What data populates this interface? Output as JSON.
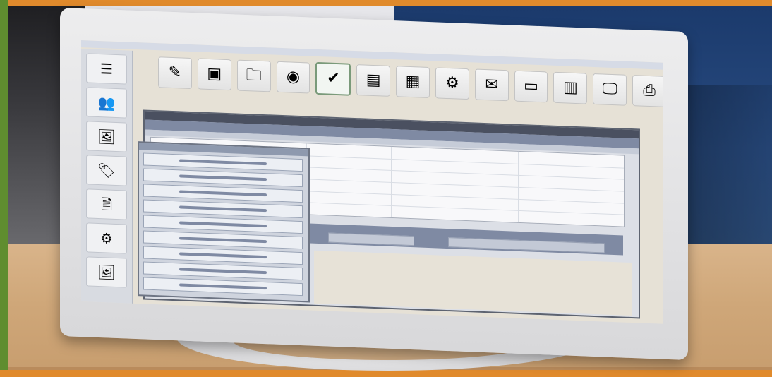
{
  "scene": {
    "description": "",
    "colors": {
      "frame_orange": "#e08a2c",
      "frame_green": "#5f8d2f",
      "desk": "#cfa779",
      "monitor_bezel": "#e2e2e4",
      "wall_blue": "#284b80"
    }
  },
  "toolbar": {
    "buttons": [
      {
        "icon": "pen-icon",
        "label": ""
      },
      {
        "icon": "box-icon",
        "label": ""
      },
      {
        "icon": "folder-icon",
        "label": ""
      },
      {
        "icon": "record-icon",
        "label": ""
      },
      {
        "icon": "check-icon",
        "label": ""
      },
      {
        "icon": "chart-icon",
        "label": ""
      },
      {
        "icon": "document-icon",
        "label": ""
      },
      {
        "icon": "cog-icon",
        "label": ""
      },
      {
        "icon": "mail-icon",
        "label": ""
      },
      {
        "icon": "window-icon",
        "label": ""
      },
      {
        "icon": "table-icon",
        "label": ""
      },
      {
        "icon": "monitor-icon",
        "label": ""
      },
      {
        "icon": "print-icon",
        "label": ""
      }
    ]
  },
  "sidebar": {
    "buttons": [
      {
        "icon": "list-icon"
      },
      {
        "icon": "people-icon"
      },
      {
        "icon": "image-icon"
      },
      {
        "icon": "tag-icon"
      },
      {
        "icon": "file-icon"
      },
      {
        "icon": "settings-icon"
      },
      {
        "icon": "image-icon"
      }
    ]
  },
  "main_window": {
    "title": "",
    "headers": [
      "",
      "",
      "",
      ""
    ],
    "rows": 6,
    "footer": [
      "",
      ""
    ]
  },
  "list_panel": {
    "items": [
      "",
      "",
      "",
      "",
      "",
      "",
      "",
      "",
      ""
    ]
  }
}
